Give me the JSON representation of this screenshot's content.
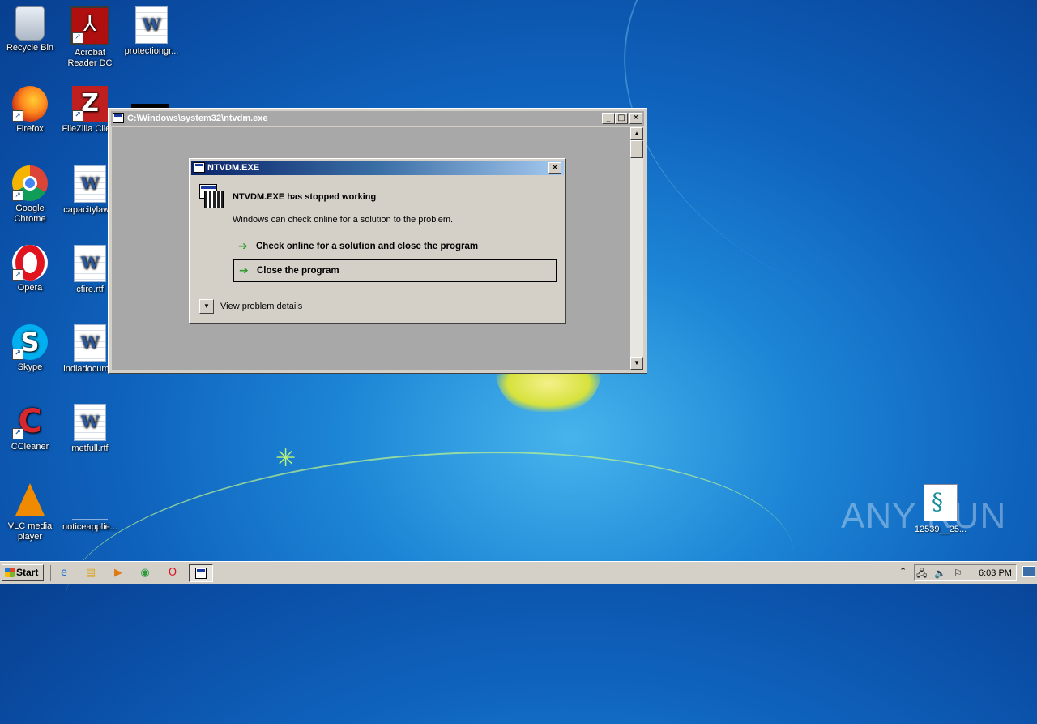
{
  "desktop": {
    "icons": [
      {
        "label": "Recycle Bin",
        "icon": "recycle-bin-icon"
      },
      {
        "label": "Acrobat Reader DC",
        "icon": "acrobat-icon"
      },
      {
        "label": "protectiongr...",
        "icon": "word-doc-icon"
      },
      {
        "label": "Firefox",
        "icon": "firefox-icon"
      },
      {
        "label": "FileZilla Clie...",
        "icon": "filezilla-icon"
      },
      {
        "label": "Google Chrome",
        "icon": "chrome-icon"
      },
      {
        "label": "capacitylaw...",
        "icon": "word-doc-icon"
      },
      {
        "label": "Opera",
        "icon": "opera-icon"
      },
      {
        "label": "cfire.rtf",
        "icon": "word-doc-icon"
      },
      {
        "label": "Skype",
        "icon": "skype-icon"
      },
      {
        "label": "indiadocum...",
        "icon": "word-doc-icon"
      },
      {
        "label": "CCleaner",
        "icon": "ccleaner-icon"
      },
      {
        "label": "metfull.rtf",
        "icon": "word-doc-icon"
      },
      {
        "label": "VLC media player",
        "icon": "vlc-icon"
      },
      {
        "label": "noticeapplie...",
        "icon": "blank-file-icon"
      }
    ],
    "bottom_file": {
      "label": "12539__25...",
      "icon": "script-file-icon"
    },
    "watermark": "ANY RUN"
  },
  "console_window": {
    "title": "C:\\Windows\\system32\\ntvdm.exe",
    "minimize": "_",
    "maximize": "□",
    "close": "✕",
    "scroll_up": "▲",
    "scroll_down": "▼"
  },
  "error_dialog": {
    "title": "NTVDM.EXE",
    "close": "✕",
    "heading": "NTVDM.EXE has stopped working",
    "description": "Windows can check online for a solution to the problem.",
    "options": [
      {
        "label": "Check online for a solution and close the program",
        "focused": false
      },
      {
        "label": "Close the program",
        "focused": true
      }
    ],
    "arrow_glyph": "➔",
    "details_toggle_glyph": "▼",
    "details_label": "View problem details"
  },
  "taskbar": {
    "start_label": "Start",
    "quick_launch": [
      "ie-icon",
      "explorer-icon",
      "media-player-icon",
      "chrome-icon",
      "opera-icon"
    ],
    "active_task": "ntvdm-console-icon",
    "tray_expand": "⌃",
    "tray_icons": [
      "network-icon",
      "volume-icon",
      "flag-icon"
    ],
    "clock": "6:03 PM"
  },
  "colors": {
    "dialog_title_start": "#0a246a",
    "dialog_title_end": "#a6caf0",
    "window_face": "#d4d0c8",
    "console_bg": "#a8a8a8",
    "option_arrow": "#2f9e2f"
  }
}
